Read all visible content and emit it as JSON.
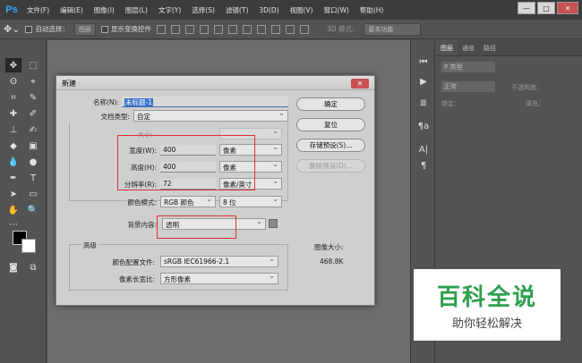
{
  "app": {
    "logo": "Ps"
  },
  "menubar": {
    "items": [
      "文件(F)",
      "编辑(E)",
      "图像(I)",
      "图层(L)",
      "文字(Y)",
      "选择(S)",
      "滤镜(T)",
      "3D(D)",
      "视图(V)",
      "窗口(W)",
      "帮助(H)"
    ]
  },
  "window_buttons": {
    "minimize": "—",
    "maximize": "□",
    "close": "✕"
  },
  "optbar": {
    "auto_select": "自动选择：",
    "auto_select_value": "图层",
    "show_transform": "显示变换控件",
    "mode_3d": "3D 模式：",
    "workspace": "基本功能"
  },
  "layers_panel": {
    "tabs": [
      "图层",
      "通道",
      "路径"
    ],
    "kind": "P 类型",
    "blend": "正常",
    "opacity": "不透明度：",
    "lock": "锁定：",
    "fill": "填充："
  },
  "dialog": {
    "title": "新建",
    "close": "✕",
    "name_label": "名称(N):",
    "name_value": "未标题-1",
    "doc_type_label": "文档类型:",
    "doc_type_value": "自定",
    "size_label": "大小:",
    "width_label": "宽度(W):",
    "width_value": "400",
    "width_unit": "像素",
    "height_label": "高度(H):",
    "height_value": "400",
    "height_unit": "像素",
    "res_label": "分辨率(R):",
    "res_value": "72",
    "res_unit": "像素/英寸",
    "color_mode_label": "颜色模式:",
    "color_mode_value": "RGB 颜色",
    "bit_depth": "8 位",
    "bg_label": "背景内容:",
    "bg_value": "透明",
    "advanced": "高级",
    "profile_label": "颜色配置文件:",
    "profile_value": "sRGB IEC61966-2.1",
    "aspect_label": "像素长宽比:",
    "aspect_value": "方形像素",
    "image_size_label": "图像大小:",
    "image_size_value": "468.8K",
    "buttons": {
      "ok": "确定",
      "reset": "复位",
      "save_preset": "存储预设(S)...",
      "delete_preset": "删除预设(D)..."
    }
  },
  "watermark": {
    "title": "百科全说",
    "subtitle": "助你轻松解决"
  },
  "colors": {
    "highlight": "#e03030",
    "watermark_green": "#2e9f4d"
  }
}
